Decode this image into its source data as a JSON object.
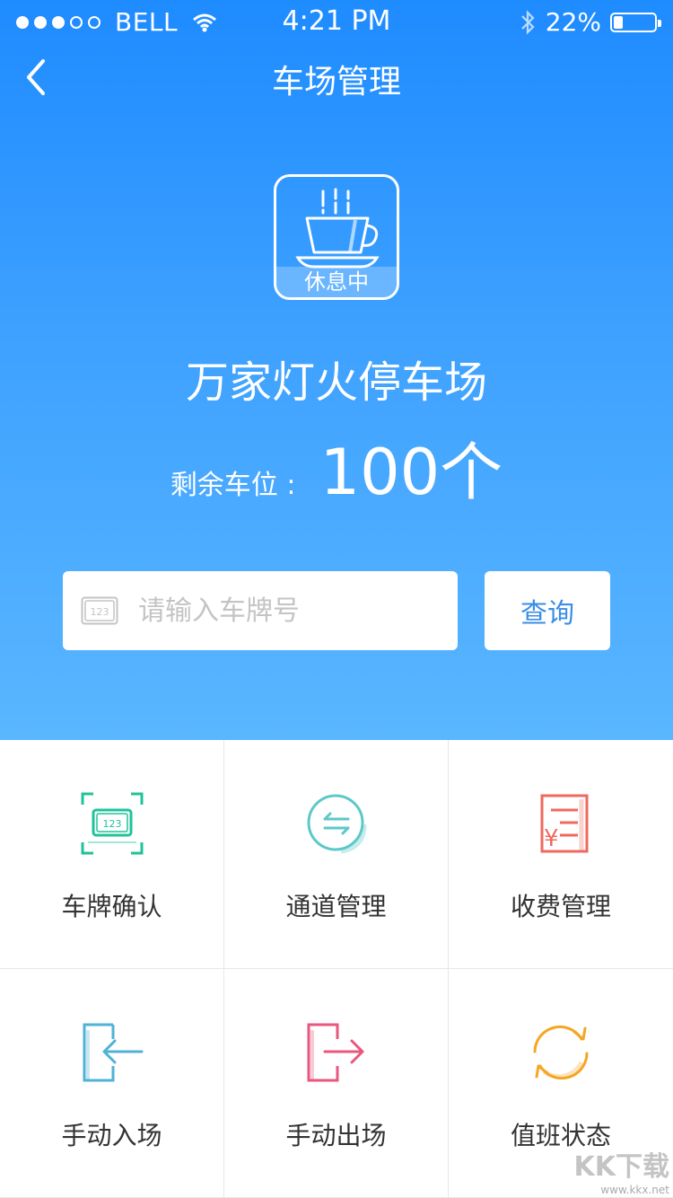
{
  "status_bar": {
    "carrier": "BELL",
    "time": "4:21 PM",
    "battery": "22%",
    "battery_level": 0.22,
    "signal_dots": 5,
    "signal_filled": 3
  },
  "nav": {
    "title": "车场管理",
    "back_icon": "chevron-left-icon"
  },
  "lot_status": {
    "label": "休息中",
    "icon": "coffee-cup-icon"
  },
  "lot": {
    "name": "万家灯火停车场",
    "remaining_label": "剩余车位 :",
    "remaining_value": "100个"
  },
  "search": {
    "placeholder": "请输入车牌号",
    "value": "",
    "button": "查询",
    "icon": "license-plate-icon"
  },
  "menu": [
    {
      "label": "车牌确认",
      "icon": "plate-scan-icon",
      "color": "#1fc39a"
    },
    {
      "label": "通道管理",
      "icon": "swap-arrows-icon",
      "color": "#5cc8c8"
    },
    {
      "label": "收费管理",
      "icon": "fee-receipt-icon",
      "color": "#ee6a5e"
    },
    {
      "label": "手动入场",
      "icon": "enter-icon",
      "color": "#4fb2d6"
    },
    {
      "label": "手动出场",
      "icon": "exit-icon",
      "color": "#e9567e"
    },
    {
      "label": "值班状态",
      "icon": "refresh-cycle-icon",
      "color": "#f5a623"
    }
  ],
  "watermark": {
    "text": "KK下载",
    "url": "www.kkx.net"
  }
}
